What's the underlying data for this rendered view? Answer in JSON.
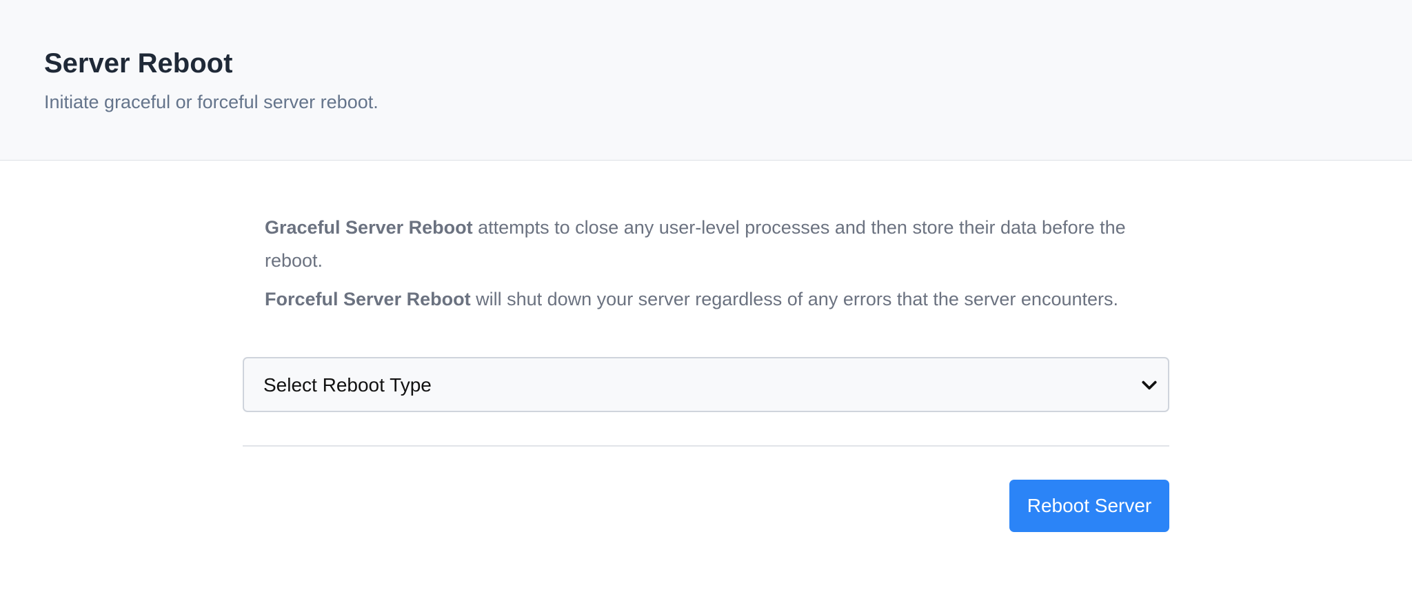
{
  "header": {
    "title": "Server Reboot",
    "subtitle": "Initiate graceful or forceful server reboot."
  },
  "description": {
    "graceful": {
      "bold": "Graceful Server Reboot",
      "text": " attempts to close any user-level processes and then store their data before the reboot."
    },
    "forceful": {
      "bold": "Forceful Server Reboot",
      "text": " will shut down your server regardless of any errors that the server encounters."
    }
  },
  "select": {
    "selected_value": "Select Reboot Type",
    "icon": "chevron-down-icon"
  },
  "actions": {
    "reboot_label": "Reboot Server"
  },
  "colors": {
    "primary": "#2b84f7",
    "title": "#1f2937",
    "muted": "#6b7280",
    "header_bg": "#f8f9fb"
  }
}
